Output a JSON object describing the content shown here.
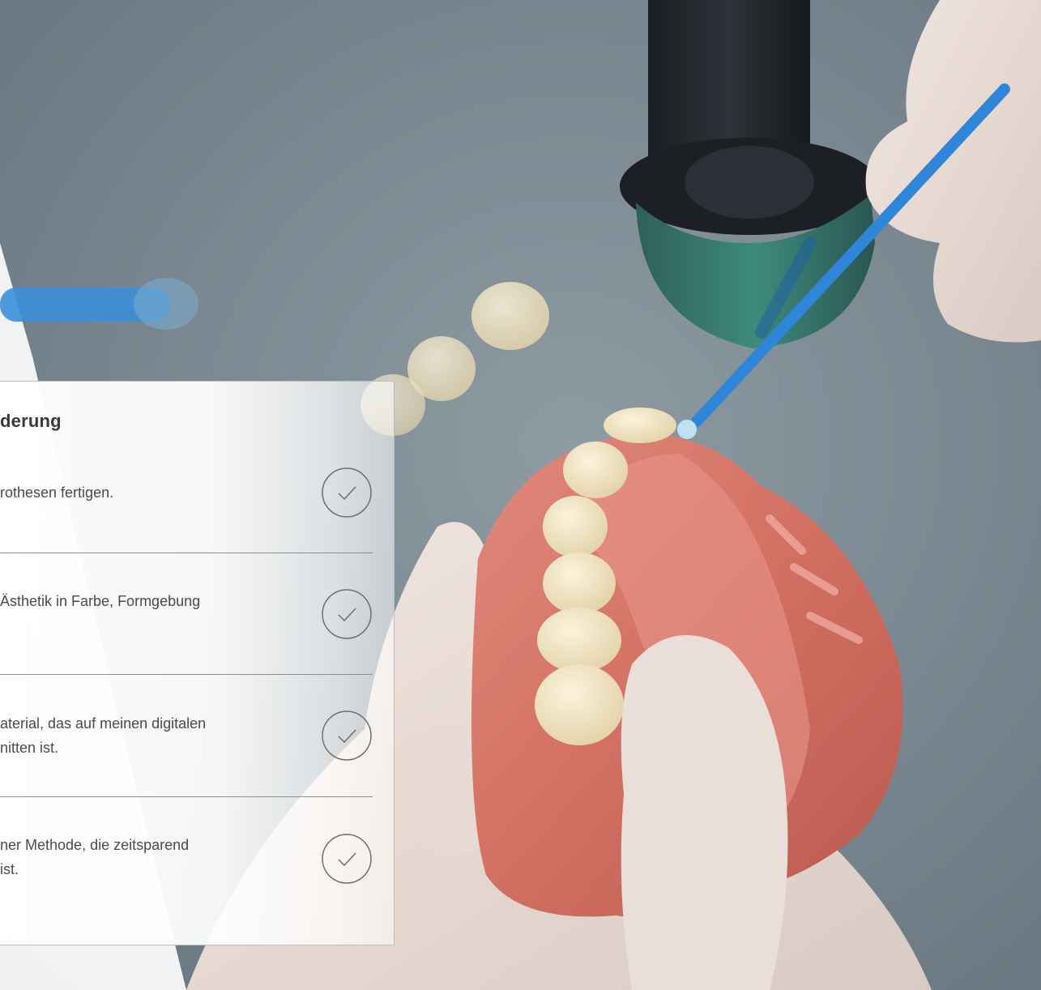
{
  "card": {
    "title": "derung",
    "items": [
      {
        "text": "rothesen fertigen.",
        "icon": "check-circle-icon"
      },
      {
        "text": "Ästhetik in Farbe, Formgebung",
        "icon": "check-circle-icon"
      },
      {
        "text": "aterial, das auf meinen digitalen\nnitten ist.",
        "icon": "check-circle-icon"
      },
      {
        "text": "ner Methode, die zeitsparend\n ist.",
        "icon": "check-circle-icon"
      }
    ]
  },
  "colors": {
    "background": "#7d8a93",
    "denture_pink": "#d9776a",
    "applicator_blue": "#2f86d8",
    "text": "#4a4a4a",
    "divider": "#8a8f93"
  }
}
